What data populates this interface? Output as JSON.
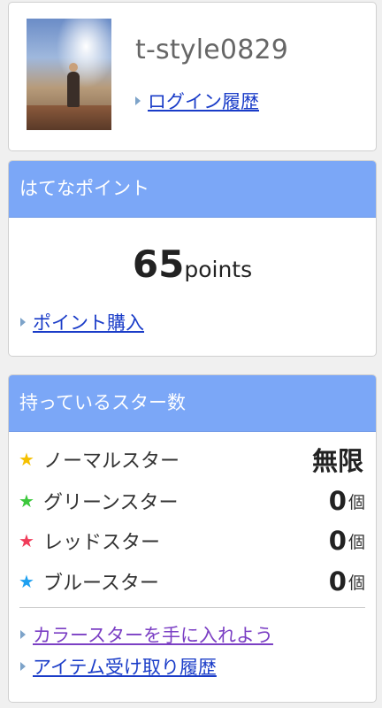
{
  "profile": {
    "username": "t-style0829",
    "login_history_link": "ログイン履歴"
  },
  "points": {
    "header": "はてなポイント",
    "value": "65",
    "unit": "points",
    "purchase_link": "ポイント購入"
  },
  "stars": {
    "header": "持っているスター数",
    "items": [
      {
        "label": "ノーマルスター",
        "value": "無限",
        "unit": "",
        "color": "#f5c000"
      },
      {
        "label": "グリーンスター",
        "value": "0",
        "unit": "個",
        "color": "#3cc83c"
      },
      {
        "label": "レッドスター",
        "value": "0",
        "unit": "個",
        "color": "#f03c5a"
      },
      {
        "label": "ブルースター",
        "value": "0",
        "unit": "個",
        "color": "#1ea0f0"
      }
    ],
    "color_star_link": "カラースターを手に入れよう",
    "item_history_link": "アイテム受け取り履歴"
  }
}
